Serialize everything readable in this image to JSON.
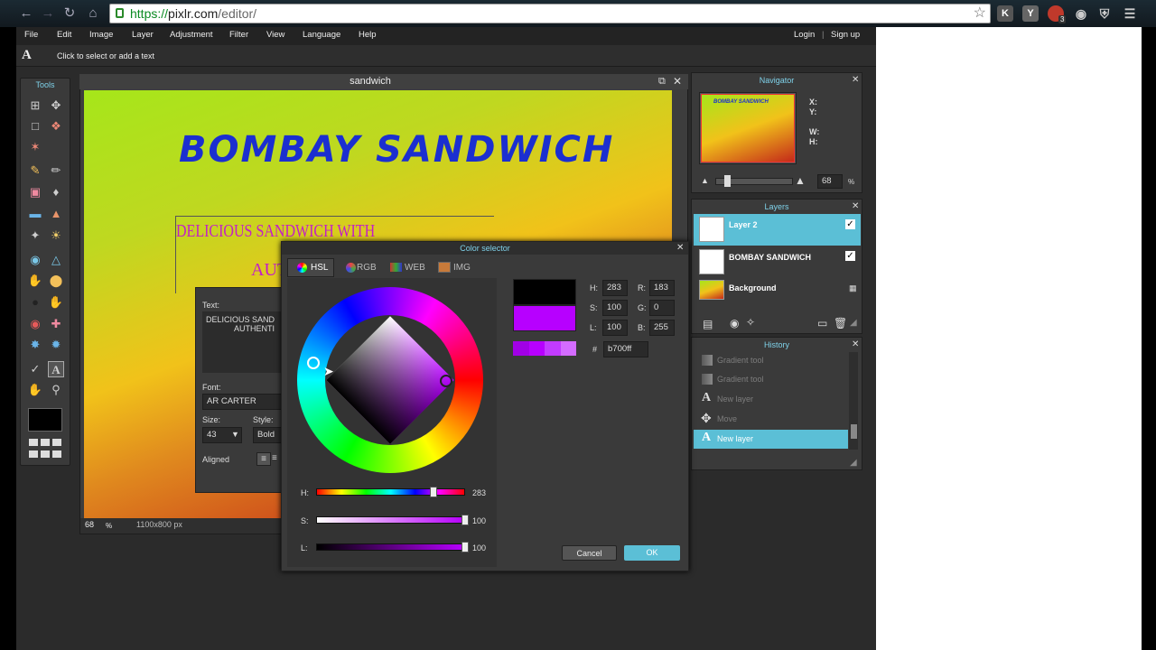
{
  "browser": {
    "url_scheme": "https://",
    "url_host": "pixlr.com",
    "url_path": "/editor/",
    "ext_k": "K",
    "ext_y": "Y",
    "ext_badge": "3"
  },
  "menubar": {
    "items": [
      "File",
      "Edit",
      "Image",
      "Layer",
      "Adjustment",
      "Filter",
      "View",
      "Language",
      "Help"
    ],
    "login": "Login",
    "separator": "|",
    "signup": "Sign up"
  },
  "optionsbar": {
    "hint": "Click to select or add a text"
  },
  "tools": {
    "title": "Tools"
  },
  "document": {
    "title": "sandwich",
    "headline": "BOMBAY SANDWICH",
    "subline1": "DELICIOUS SANDWICH WITH",
    "subline2": "AUT",
    "zoom": "68",
    "zoom_unit": "%",
    "size": "1100x800 px"
  },
  "textpanel": {
    "text_label": "Text:",
    "text_line1": "DELICIOUS SAND",
    "text_line2": "AUTHENTI",
    "font_label": "Font:",
    "font_value": "AR CARTER",
    "size_label": "Size:",
    "size_value": "43",
    "style_label": "Style:",
    "style_value": "Bold",
    "aligned_label": "Aligned"
  },
  "navigator": {
    "title": "Navigator",
    "thumb_text": "BOMBAY SANDWICH",
    "x_label": "X:",
    "y_label": "Y:",
    "w_label": "W:",
    "h_label": "H:",
    "zoom": "68",
    "zoom_unit": "%"
  },
  "layers": {
    "title": "Layers",
    "items": [
      {
        "name": "Layer 2",
        "selected": true
      },
      {
        "name": "BOMBAY SANDWICH",
        "selected": false
      },
      {
        "name": "Background",
        "selected": false
      }
    ]
  },
  "history": {
    "title": "History",
    "items": [
      "Gradient tool",
      "Gradient tool",
      "New layer",
      "Move",
      "New layer"
    ]
  },
  "colorselector": {
    "title": "Color selector",
    "tabs": [
      "HSL",
      "RGB",
      "WEB",
      "IMG"
    ],
    "active_tab": "HSL",
    "h_label": "H:",
    "h_value": "283",
    "s_label": "S:",
    "s_value": "100",
    "l_label": "L:",
    "l_value": "100",
    "r_label": "R:",
    "r_value": "183",
    "g_label": "G:",
    "g_value": "0",
    "b_label": "B:",
    "b_value": "255",
    "hash_label": "#",
    "hex_value": "b700ff",
    "slider_h_label": "H:",
    "slider_h_value": "283",
    "slider_s_label": "S:",
    "slider_s_value": "100",
    "slider_l_label": "L:",
    "slider_l_value": "100",
    "slider_h_level": 0.79,
    "slider_s_level": 1.0,
    "slider_l_level": 1.0,
    "old_color": "#000000",
    "new_color": "#b700ff",
    "cancel_label": "Cancel",
    "ok_label": "OK"
  },
  "colors": {
    "accent": "#5bbfd6",
    "headline": "#1b2fd0",
    "subline": "#c31ec8"
  }
}
